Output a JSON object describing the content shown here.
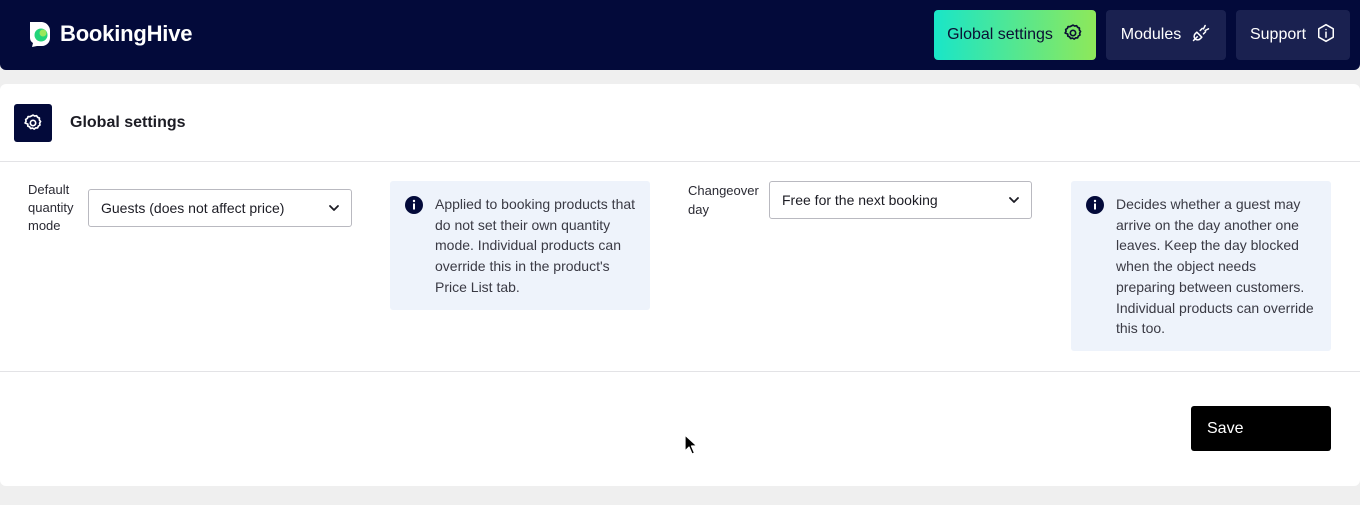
{
  "brand": {
    "name": "BookingHive"
  },
  "nav": {
    "global_settings": "Global settings",
    "modules": "Modules",
    "support": "Support"
  },
  "page": {
    "title": "Global settings"
  },
  "fields": {
    "quantity": {
      "label": "Default quantity mode",
      "value": "Guests (does not affect price)",
      "info": "Applied to booking products that do not set their own quantity mode. Individual products can override this in the product's Price List tab."
    },
    "changeover": {
      "label": "Changeover day",
      "value": "Free for the next booking",
      "info": "Decides whether a guest may arrive on the day another one leaves. Keep the day blocked when the object needs preparing between customers. Individual products can override this too."
    }
  },
  "actions": {
    "save": "Save"
  },
  "colors": {
    "navy": "#030a3a",
    "accent_start": "#19e6c8",
    "accent_end": "#8ee85a",
    "info_bg": "#eef3fb"
  },
  "icons": [
    "brand-logo-icon",
    "gear-icon",
    "plug-icon",
    "info-hexagon-icon",
    "chevron-down-icon",
    "info-icon",
    "cursor-icon"
  ]
}
